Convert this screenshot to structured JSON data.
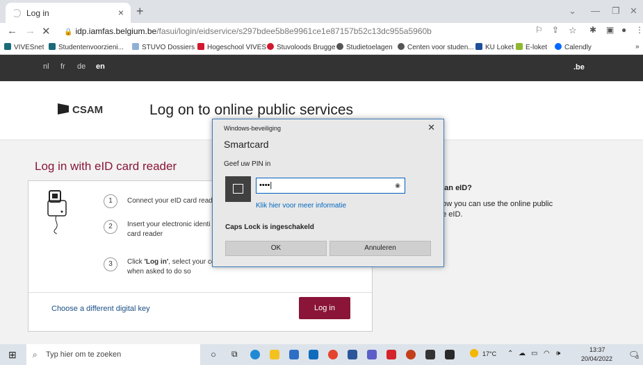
{
  "browser": {
    "tab_title": "Log in",
    "url_host": "idp.iamfas.belgium.be",
    "url_path": "/fasui/login/eidservice/s297bdee5b8e9961ce1e87157b52c13dc955a5960b",
    "bookmarks": [
      {
        "label": "VIVESnet",
        "color": "#1a6b7a"
      },
      {
        "label": "Studentenvoorzieni...",
        "color": "#1a6b7a"
      },
      {
        "label": "STUVO Dossiers",
        "color": "#8fb0d6"
      },
      {
        "label": "Hogeschool VIVES",
        "color": "#d0182e"
      },
      {
        "label": "Stuvoloods Brugge",
        "color": "#d0182e"
      },
      {
        "label": "Studietoelagen",
        "color": "#555555"
      },
      {
        "label": "Centen voor studen...",
        "color": "#555555"
      },
      {
        "label": "KU Loket",
        "color": "#1f4e9c"
      },
      {
        "label": "E-loket",
        "color": "#8db830"
      },
      {
        "label": "Calendly",
        "color": "#0069ff"
      }
    ]
  },
  "site": {
    "languages": [
      "nl",
      "fr",
      "de",
      "en"
    ],
    "active_language": "en",
    "be_label": ".be",
    "logo": "CSAM",
    "page_title": "Log on to online public services",
    "section_title": "Log in with eID card reader",
    "steps": [
      {
        "num": "1",
        "text": "Connect your eID card read"
      },
      {
        "num": "2",
        "text": "Insert your electronic identi",
        "text2": "card reader"
      },
      {
        "num": "3",
        "text_pre": "Click ",
        "text_bold": "'Log in'",
        "text_post": ", select your ce",
        "text2": "when asked to do so"
      }
    ],
    "choose_label": "Choose a different digital key",
    "login_button": "Log in",
    "eid_title": "e an eID?",
    "eid_line1": "how you can use the online public",
    "eid_line2": "he eID."
  },
  "dialog": {
    "title": "Windows-beveiliging",
    "heading": "Smartcard",
    "prompt": "Geef uw PIN in",
    "pin_value": "••••",
    "more_info": "Klik hier voor meer informatie",
    "caps_lock": "Caps Lock is ingeschakeld",
    "ok": "OK",
    "cancel": "Annuleren"
  },
  "taskbar": {
    "search_placeholder": "Typ hier om te zoeken",
    "temperature": "17°C",
    "time": "13:37",
    "date": "20/04/2022",
    "notification_count": "3"
  }
}
